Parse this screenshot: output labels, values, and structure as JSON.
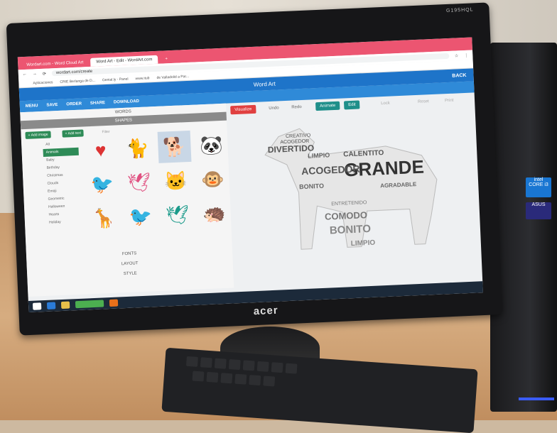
{
  "browser": {
    "tabs": [
      {
        "label": "Wordart.com - Word Cloud Art"
      },
      {
        "label": "Word Art - Edit - WordArt.com"
      }
    ],
    "url": "wordart.com/create",
    "bookmarks": [
      "Aplicaciones",
      "CRIE Berlanga de D...",
      "Genial.ly - Panel",
      "www.itub",
      "de Valladolid a Par..."
    ]
  },
  "app": {
    "title": "Word Art",
    "back_label": "BACK",
    "toolbar": [
      "MENU",
      "SAVE",
      "ORDER",
      "SHARE",
      "DOWNLOAD"
    ]
  },
  "left_panel": {
    "sections": [
      "WORDS",
      "SHAPES",
      "FONTS",
      "LAYOUT",
      "STYLE"
    ],
    "add_image_label": "+ Add image",
    "add_text_label": "+ Add text",
    "filter_placeholder": "Filter",
    "categories": [
      "All",
      "Animals",
      "Baby",
      "Birthday",
      "Christmas",
      "Clouds",
      "Emoji",
      "Geometric",
      "Halloween",
      "Hearts",
      "Holiday"
    ],
    "selected_category": "Animals",
    "shapes": [
      "heart",
      "cat",
      "dog",
      "panda",
      "bird",
      "bird",
      "cat-outline",
      "monkey",
      "giraffe",
      "bird",
      "bird",
      "hedgehog"
    ]
  },
  "right_panel": {
    "visualize_label": "Visualize",
    "undo_label": "Undo",
    "redo_label": "Redo",
    "animate_label": "Animate",
    "edit_label": "Edit",
    "lock_label": "Lock",
    "reset_label": "Reset",
    "print_label": "Print"
  },
  "word_cloud_words": [
    "CREATIVO",
    "ACOGEDOR",
    "DIVERTIDO",
    "LIMPIO",
    "CALENTITO",
    "GRANDE",
    "BONITO",
    "COMODO",
    "AGRADABLE",
    "ENTRETENIDO"
  ],
  "monitor": {
    "brand": "acer",
    "model": "G195HQL"
  },
  "colors": {
    "tabbar": "#ec5571",
    "appbar": "#1e74c9",
    "toolbar": "#2f8ad8",
    "selected_green": "#2e8b57",
    "visualize_red": "#e04040",
    "animate_teal": "#1f8f8a"
  }
}
